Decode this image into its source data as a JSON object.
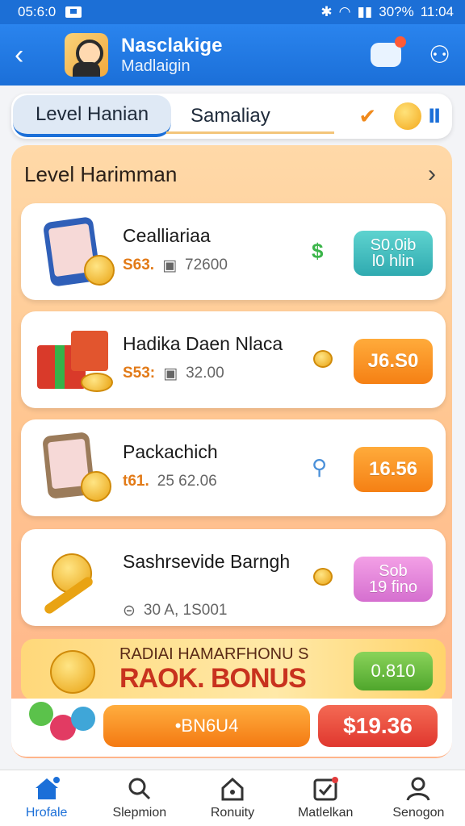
{
  "status_bar": {
    "time": "05:6:0",
    "right_text": "30?%",
    "clock": "11:04"
  },
  "header": {
    "title": "Nasclakige",
    "subtitle": "Madlaigin"
  },
  "tabs": {
    "active": "Level Hanian",
    "other": "Samaliay"
  },
  "panel": {
    "title": "Level Harimman"
  },
  "cards": [
    {
      "title": "Cealliariaa",
      "price": "S63.",
      "meta": "72600",
      "cta_line1": "S0.0ib",
      "cta_line2": "l0 hlin",
      "mid_icon": "dollar-leaf-icon"
    },
    {
      "title": "Hadika Daen Nlaca",
      "price": "S53:",
      "meta": "32.00",
      "cta": "J6.S0",
      "mid_icon": "coin-stack-icon"
    },
    {
      "title": "Packachich",
      "price": "t61.",
      "meta": "25 62.06",
      "cta": "16.56",
      "mid_icon": "key-icon"
    },
    {
      "title": "Sashrsevide Barngh",
      "meta": "30 A, 1S001",
      "cta_line1": "Sob",
      "cta_line2": "19 fino",
      "mid_icon": "coin-stack-icon"
    }
  ],
  "bonus": {
    "line1": "RADIAI HAMARFHONU S",
    "line2": "RAOK. BONUS",
    "cta": "0.810"
  },
  "actions": {
    "primary": "•BN6U4",
    "price": "$19.36"
  },
  "nav": [
    {
      "label": "Hrofale",
      "icon": "home-icon"
    },
    {
      "label": "Slepmion",
      "icon": "search-icon"
    },
    {
      "label": "Ronuity",
      "icon": "house-outline-icon"
    },
    {
      "label": "Matlelkan",
      "icon": "checklist-icon"
    },
    {
      "label": "Senogon",
      "icon": "user-icon"
    }
  ],
  "colors": {
    "primary": "#1b6fd8",
    "accent": "#f58014",
    "panel": "#ffc691",
    "danger": "#e0372e"
  }
}
